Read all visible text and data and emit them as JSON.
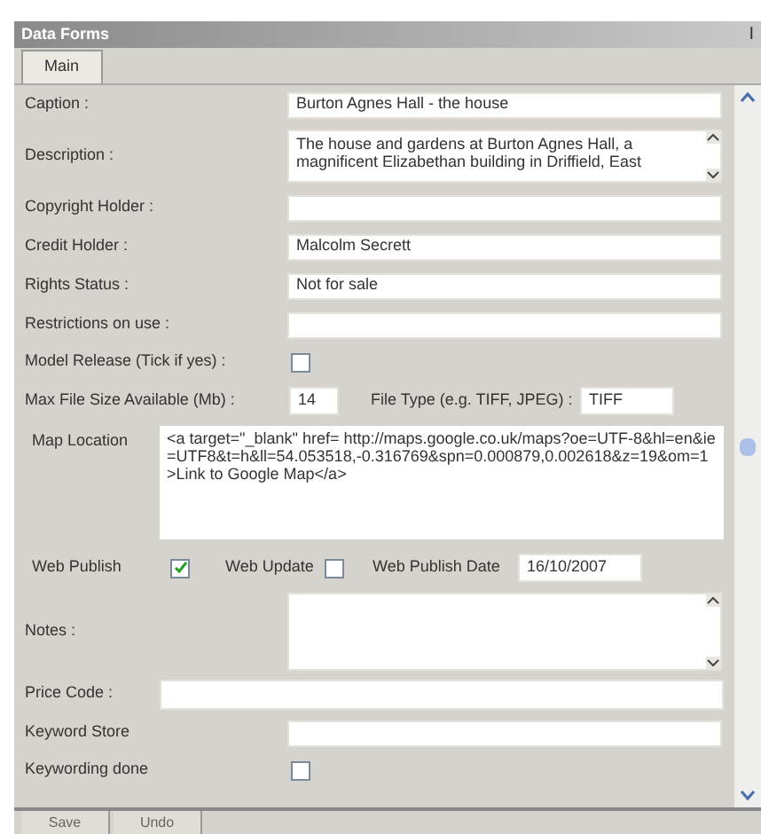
{
  "window": {
    "title": "Data Forms",
    "close": "I"
  },
  "tabs": [
    {
      "label": "Main",
      "selected": true
    }
  ],
  "rows": [
    {
      "kind": "text",
      "label": "Caption :",
      "value": "Burton Agnes Hall - the house"
    },
    {
      "kind": "memo",
      "label": "Description :",
      "value": "The house and gardens at Burton Agnes Hall, a magnificent Elizabethan building in Driffield, East"
    },
    {
      "kind": "text",
      "label": "Copyright Holder :"
    },
    {
      "kind": "text",
      "label": "Credit Holder :",
      "value": "Malcolm Secrett"
    },
    {
      "kind": "text",
      "label": "Rights Status :",
      "value": "Not for sale"
    },
    {
      "kind": "text",
      "label": "Restrictions on use :"
    },
    {
      "kind": "check",
      "label": "Model Release (Tick if yes) :",
      "checked": false
    },
    {
      "kind": "size",
      "label": "Max File Size Available (Mb) :",
      "value": "14",
      "label2": "File Type (e.g. TIFF, JPEG) :",
      "value2": "TIFF"
    },
    {
      "kind": "map",
      "label": "Map Location",
      "value": "<a target=\"_blank\" href= http://maps.google.co.uk/maps?oe=UTF-8&hl=en&ie=UTF8&t=h&ll=54.053518,-0.316769&spn=0.000879,0.002618&z=19&om=1 >Link to Google Map</a>"
    },
    {
      "kind": "publish",
      "items": [
        {
          "label": "Web Publish",
          "checked": true
        },
        {
          "label": "Web Update",
          "checked": false
        }
      ],
      "date_label": "Web Publish Date",
      "date": "16/10/2007"
    },
    {
      "kind": "memo",
      "label": "Notes :"
    },
    {
      "kind": "wide",
      "label": "Price Code :"
    },
    {
      "kind": "text",
      "label": "Keyword Store"
    },
    {
      "kind": "check",
      "label": "Keywording done",
      "checked": false
    }
  ],
  "buttons": [
    "Save",
    "Undo"
  ]
}
